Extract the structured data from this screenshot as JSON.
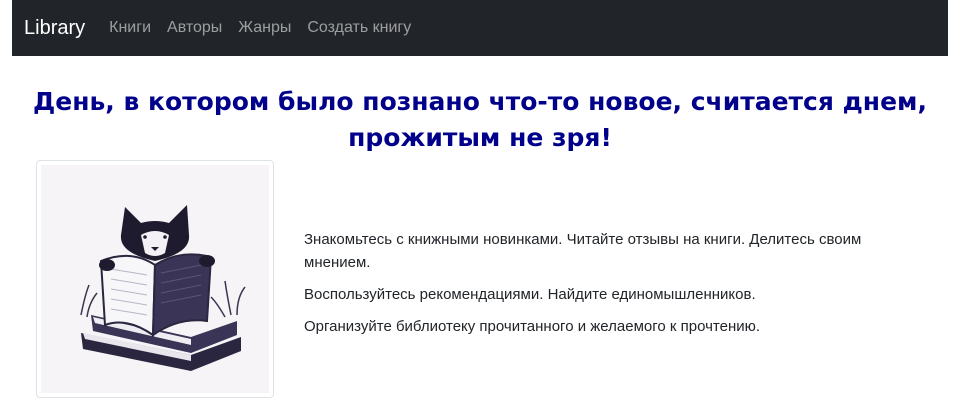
{
  "navbar": {
    "brand": "Library",
    "links": [
      {
        "label": "Книги"
      },
      {
        "label": "Авторы"
      },
      {
        "label": "Жанры"
      },
      {
        "label": "Создать книгу"
      }
    ]
  },
  "colors": {
    "navbar_bg": "#212529",
    "headline": "#00008b",
    "text": "#212529"
  },
  "main": {
    "headline": "День, в котором было познано что-то новое, считается днем, прожитым не зря!",
    "image": {
      "icon": "cat-reading-book-illustration"
    },
    "paragraphs": [
      "Знакомьтесь с книжными новинками. Читайте отзывы на книги. Делитесь своим мнением.",
      "Воспользуйтесь рекомендациями. Найдите единомышленников.",
      "Организуйте библиотеку прочитанного и желаемого к прочтению."
    ]
  }
}
